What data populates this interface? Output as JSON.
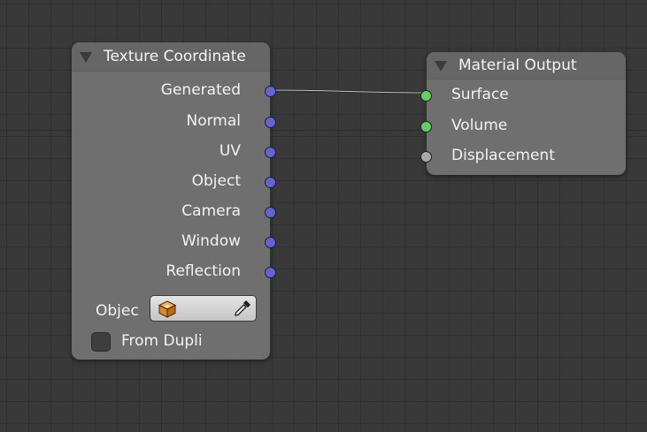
{
  "colors": {
    "canvas": "#393939",
    "node_body": "#6f6f6f",
    "socket_vector": "#6363d6",
    "socket_shader": "#63cf63",
    "socket_value": "#a8a8a8"
  },
  "nodes": {
    "texture_coordinate": {
      "title": "Texture Coordinate",
      "outputs": [
        "Generated",
        "Normal",
        "UV",
        "Object",
        "Camera",
        "Window",
        "Reflection"
      ],
      "object_label": "Objec",
      "object_value": "",
      "object_icon": "cube-icon",
      "picker_icon": "eyedropper-icon",
      "from_dupli_label": "From Dupli",
      "from_dupli_checked": false
    },
    "material_output": {
      "title": "Material Output",
      "inputs": [
        "Surface",
        "Volume",
        "Displacement"
      ]
    }
  },
  "links": [
    {
      "from": "Texture Coordinate.Generated",
      "to": "Material Output.Surface"
    }
  ]
}
